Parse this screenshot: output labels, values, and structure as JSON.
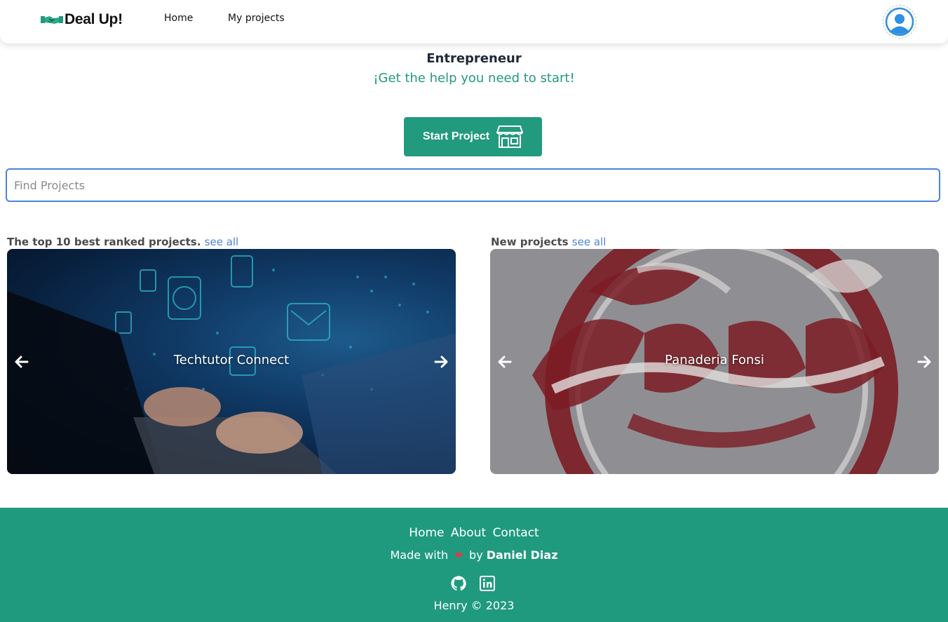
{
  "navbar": {
    "brand": "Deal Up!",
    "links": [
      "Home",
      "My projects"
    ]
  },
  "hero": {
    "title": "Entrepreneur",
    "subtitle": "¡Get the help you need to start!",
    "start_button": "Start Project"
  },
  "search": {
    "placeholder": "Find Projects",
    "value": ""
  },
  "sections": {
    "top": {
      "label": "The top 10 best ranked projects.",
      "see_all": "see all",
      "current": "Techtutor Connect"
    },
    "new": {
      "label": "New projects",
      "see_all": "see all",
      "current": "Panaderia Fonsi"
    }
  },
  "footer": {
    "links": [
      "Home",
      "About",
      "Contact"
    ],
    "made_with_prefix": "Made with",
    "made_with_by": "by",
    "author": "Daniel Diaz",
    "copyright": "Henry © 2023"
  },
  "colors": {
    "brand": "#229a7d",
    "footer_bg": "#209a7e",
    "link": "#4c84d8",
    "search_border": "#4c84d8"
  },
  "icons": [
    "handshake-icon",
    "user-avatar-icon",
    "store-icon",
    "arrow-left-icon",
    "arrow-right-icon",
    "heart-icon",
    "github-icon",
    "linkedin-icon"
  ]
}
